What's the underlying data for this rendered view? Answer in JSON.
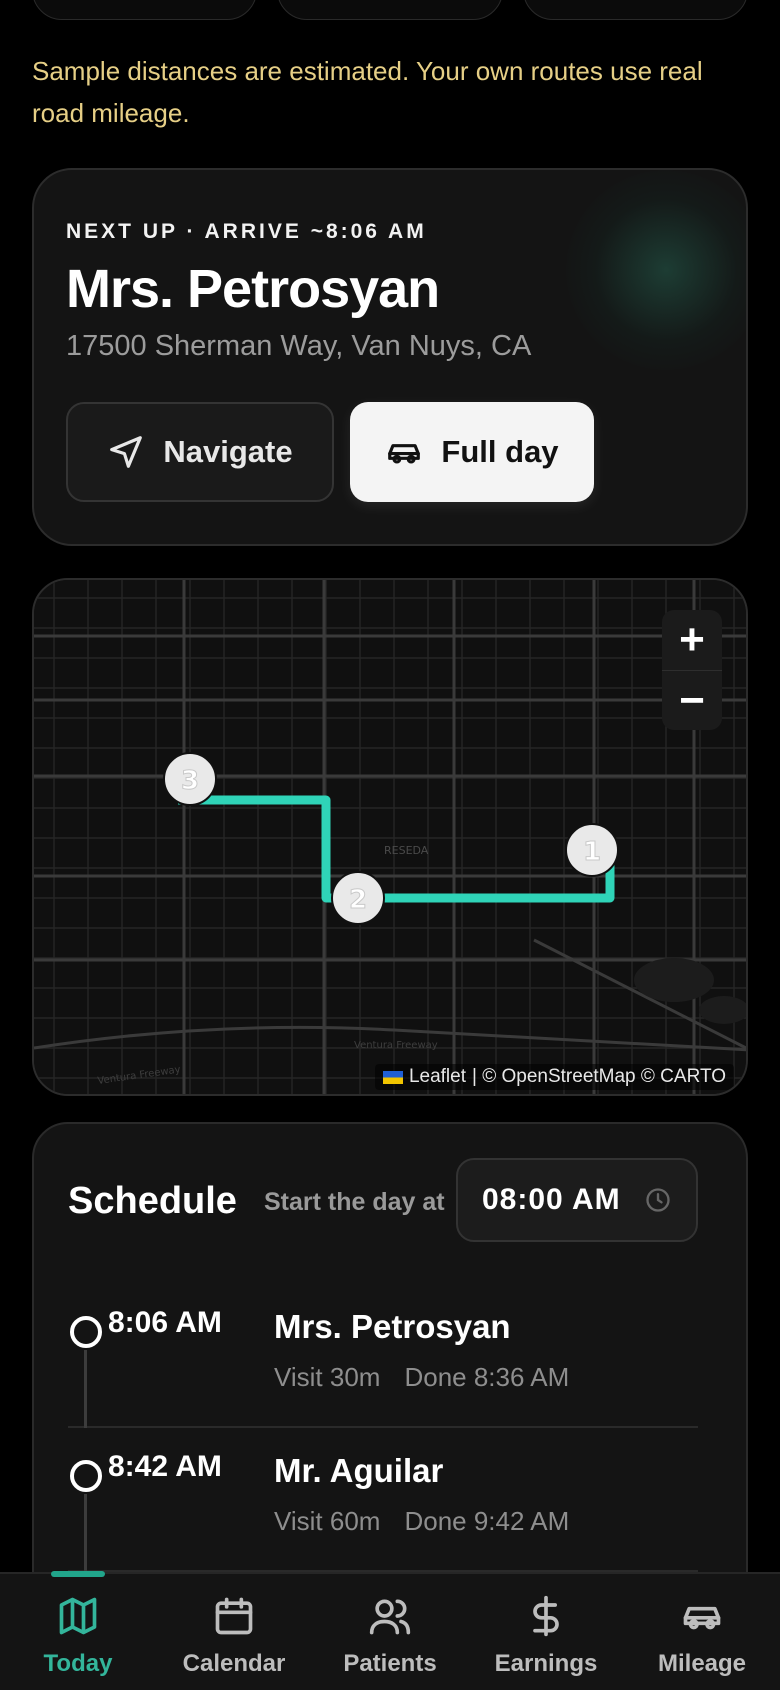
{
  "notice": "Sample distances are estimated. Your own routes use real road mileage.",
  "next_up": {
    "eyebrow": "NEXT UP · ARRIVE ~8:06 AM",
    "name": "Mrs. Petrosyan",
    "address": "17500 Sherman Way, Van Nuys, CA",
    "navigate_label": "Navigate",
    "full_day_label": "Full day"
  },
  "map": {
    "zoom_in": "+",
    "zoom_out": "−",
    "attribution_leaflet": "Leaflet",
    "attribution_rest": "| © OpenStreetMap © CARTO",
    "labels": {
      "area": "RESEDA",
      "freeway1": "Ventura Freeway",
      "freeway2": "Ventura Freeway"
    },
    "markers": [
      "1",
      "2",
      "3"
    ],
    "route_color": "#2fd4b8"
  },
  "schedule": {
    "title": "Schedule",
    "start_label": "Start the day at",
    "start_time": "08:00 AM",
    "rows": [
      {
        "time": "8:06 AM",
        "name": "Mrs. Petrosyan",
        "visit": "Visit 30m",
        "done": "Done 8:36 AM"
      },
      {
        "time": "8:42 AM",
        "name": "Mr. Aguilar",
        "visit": "Visit 60m",
        "done": "Done 9:42 AM"
      }
    ]
  },
  "tabs": [
    {
      "label": "Today",
      "icon": "map-icon",
      "active": true
    },
    {
      "label": "Calendar",
      "icon": "calendar-icon"
    },
    {
      "label": "Patients",
      "icon": "users-icon"
    },
    {
      "label": "Earnings",
      "icon": "dollar-icon"
    },
    {
      "label": "Mileage",
      "icon": "car-icon"
    }
  ],
  "colors": {
    "accent": "#33b59b",
    "notice": "#e6cf86"
  }
}
